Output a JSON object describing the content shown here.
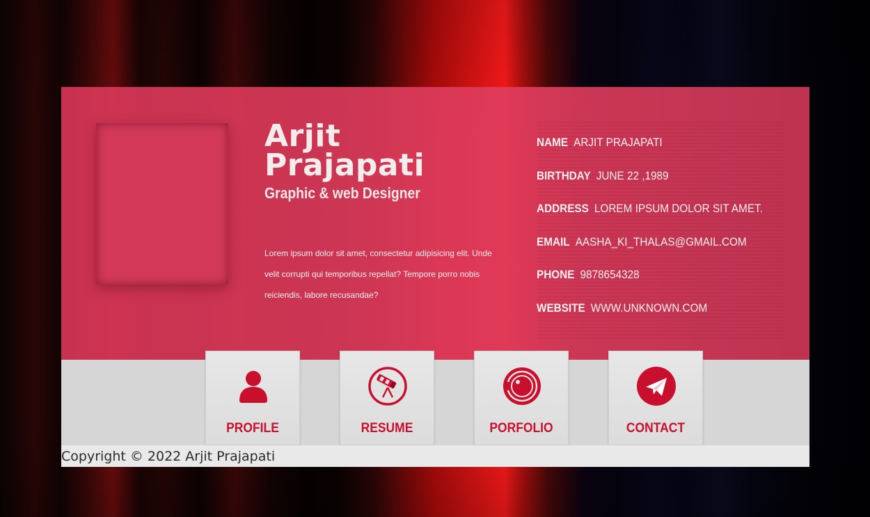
{
  "profile": {
    "name": "Arjit Prajapati",
    "name_line1": "Arjit",
    "name_line2": "Prajapati",
    "role": "Graphic & web Designer",
    "bio": "Lorem ipsum dolor sit amet, consectetur adipisicing elit. Unde velit corrupti qui temporibus repellat? Tempore porro nobis reiciendis, labore recusandae?"
  },
  "info": [
    {
      "label": "NAME",
      "value": "ARJIT PRAJAPATI"
    },
    {
      "label": "BIRTHDAY",
      "value": "JUNE 22 ,1989"
    },
    {
      "label": "ADDRESS",
      "value": "LOREM IPSUM DOLOR SIT AMET."
    },
    {
      "label": "EMAIL",
      "value": "AASHA_KI_THALAS@GMAIL.COM"
    },
    {
      "label": "PHONE",
      "value": "9878654328"
    },
    {
      "label": "WEBSITE",
      "value": "WWW.UNKNOWN.COM"
    }
  ],
  "nav": [
    {
      "label": "PROFILE",
      "icon": "user-icon"
    },
    {
      "label": "RESUME",
      "icon": "telescope-icon"
    },
    {
      "label": "PORFOLIO",
      "icon": "portfolio-icon"
    },
    {
      "label": "CONTACT",
      "icon": "paper-plane-icon"
    }
  ],
  "colors": {
    "card": "#d63656",
    "accent": "#c8102e",
    "bottom_bar": "#d6d6d6",
    "footer": "#e9e9e9"
  },
  "footer": {
    "copyright": "Copyright © 2022 Arjit Prajapati"
  }
}
